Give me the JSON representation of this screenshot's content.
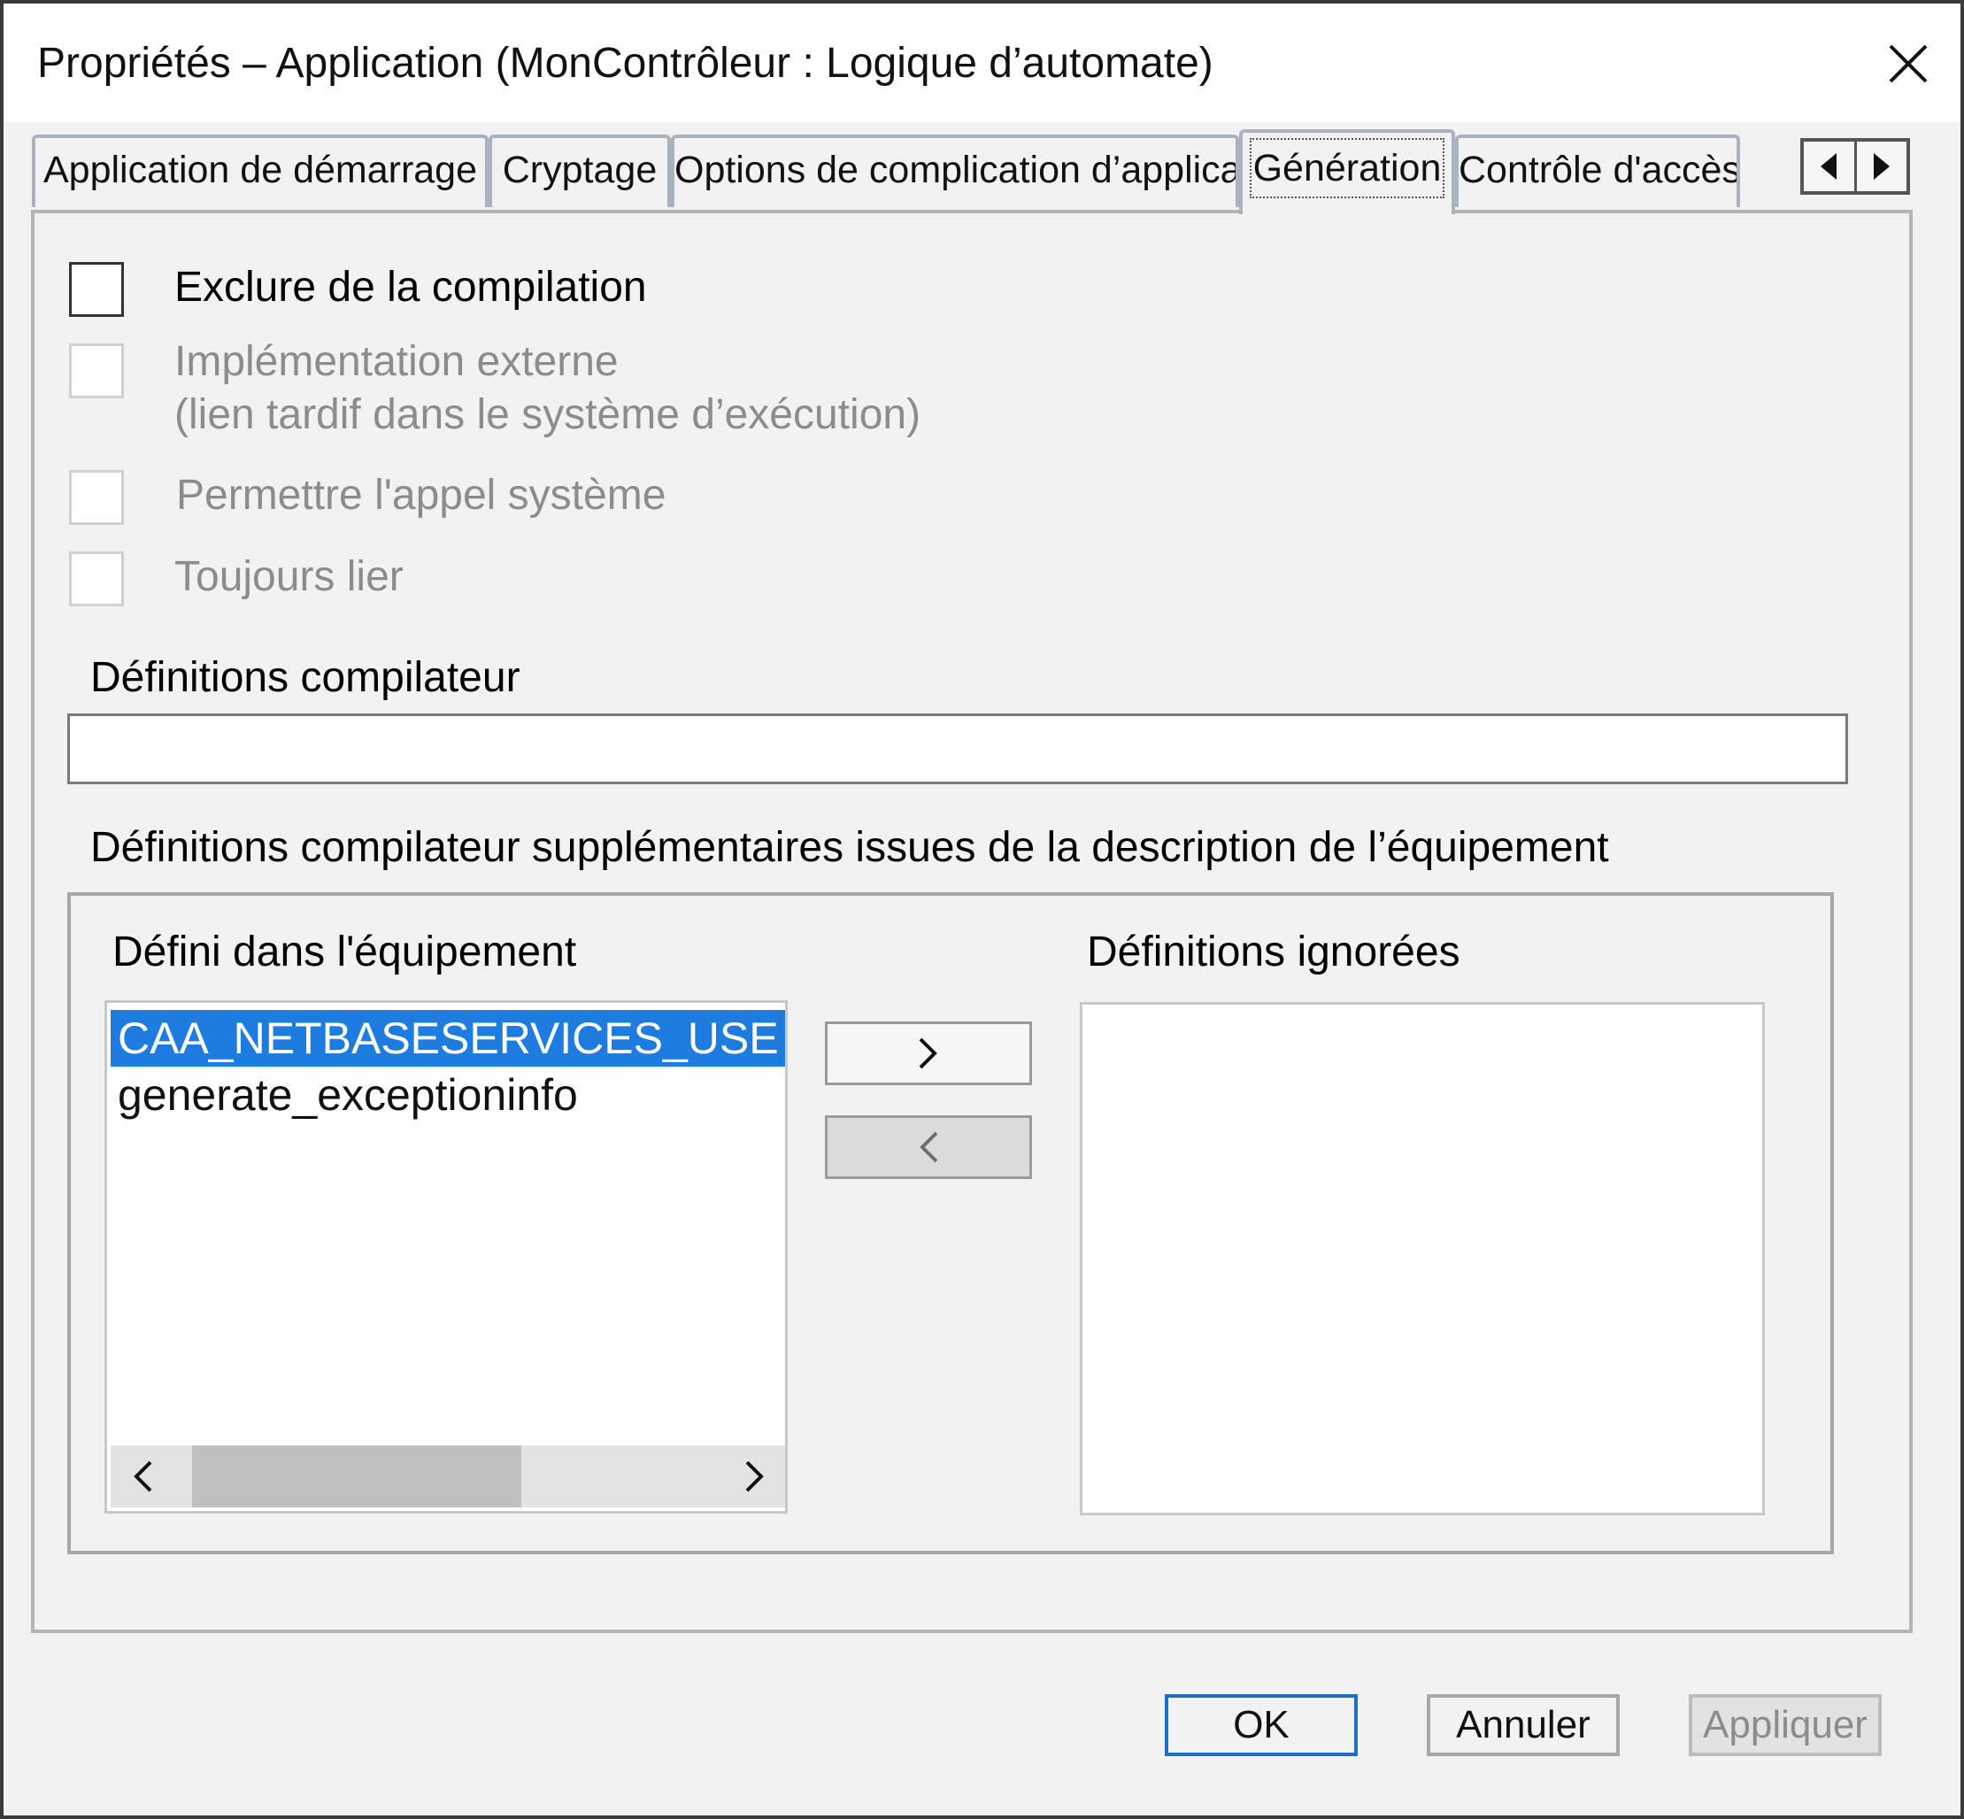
{
  "window": {
    "title": "Propriétés – Application (MonContrôleur : Logique d’automate)"
  },
  "tabs": [
    {
      "label": "Application de démarrage",
      "active": false
    },
    {
      "label": "Cryptage",
      "active": false
    },
    {
      "label": "Options de complication d’application",
      "active": false
    },
    {
      "label": "Génération",
      "active": true
    },
    {
      "label": "Contrôle d'accès",
      "active": false
    }
  ],
  "options": {
    "exclude": {
      "label": "Exclure de la compilation",
      "checked": false,
      "enabled": true
    },
    "external": {
      "line1": "Implémentation externe",
      "line2": "(lien tardif dans le système d’exécution)",
      "checked": false,
      "enabled": false
    },
    "syscall": {
      "label": "Permettre l'appel système",
      "checked": false,
      "enabled": false
    },
    "always_link": {
      "label": "Toujours lier",
      "checked": false,
      "enabled": false
    }
  },
  "compiler_defines": {
    "label": "Définitions compilateur",
    "value": ""
  },
  "device_defines": {
    "label": "Définitions compilateur supplémentaires issues de la description de l’équipement",
    "defined_label": "Défini dans l'équipement",
    "ignored_label": "Définitions ignorées",
    "defined_items": [
      "CAA_NETBASESERVICES_USE",
      "generate_exceptioninfo"
    ],
    "selected_index": 0,
    "ignored_items": []
  },
  "buttons": {
    "ok": "OK",
    "cancel": "Annuler",
    "apply": "Appliquer"
  },
  "colors": {
    "selection": "#1e7ce0",
    "default_button_border": "#1e6fc8",
    "dialog_bg": "#f2f2f2"
  }
}
